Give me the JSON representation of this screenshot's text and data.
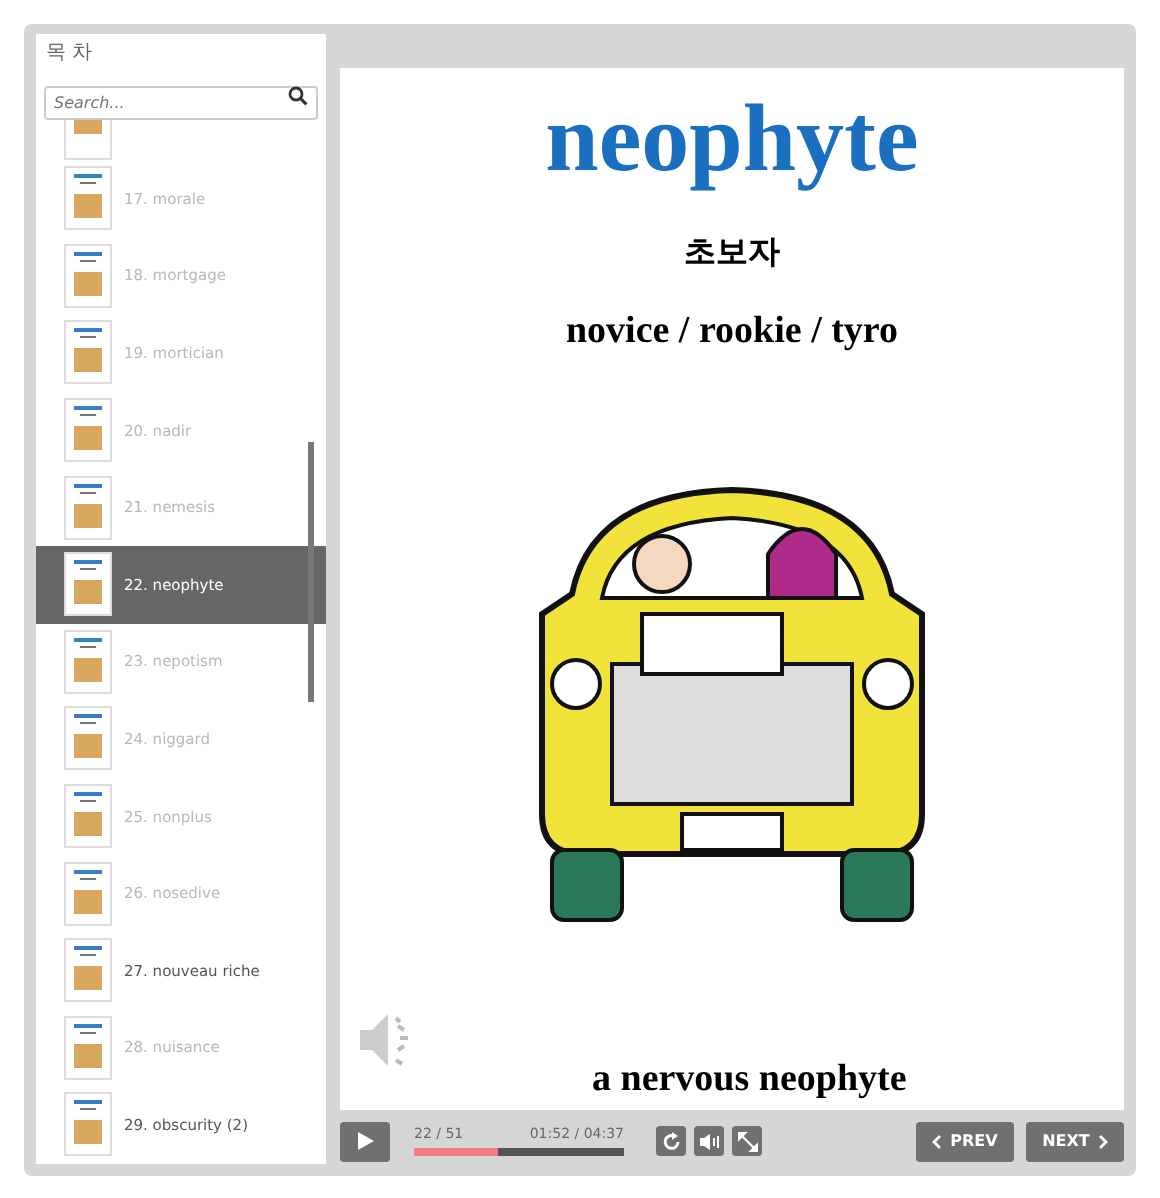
{
  "sidebar": {
    "title": "목 차",
    "search": {
      "placeholder": "Search..."
    },
    "items": [
      {
        "label": "17. morale",
        "selected": false,
        "viewed": true
      },
      {
        "label": "18. mortgage",
        "selected": false,
        "viewed": true
      },
      {
        "label": "19. mortician",
        "selected": false,
        "viewed": true
      },
      {
        "label": "20. nadir",
        "selected": false,
        "viewed": true
      },
      {
        "label": "21. nemesis",
        "selected": false,
        "viewed": true
      },
      {
        "label": "22. neophyte",
        "selected": true,
        "viewed": true
      },
      {
        "label": "23. nepotism",
        "selected": false,
        "viewed": true
      },
      {
        "label": "24. niggard",
        "selected": false,
        "viewed": true
      },
      {
        "label": "25. nonplus",
        "selected": false,
        "viewed": true
      },
      {
        "label": "26. nosedive",
        "selected": false,
        "viewed": true
      },
      {
        "label": "27. nouveau riche",
        "selected": false,
        "viewed": false
      },
      {
        "label": "28. nuisance",
        "selected": false,
        "viewed": true
      },
      {
        "label": "29. obscurity (2)",
        "selected": false,
        "viewed": false
      }
    ]
  },
  "slide": {
    "word": "neophyte",
    "korean": "초보자",
    "synonyms": "novice / rookie / tyro",
    "caption": "a nervous neophyte"
  },
  "player": {
    "slide_count": "22 / 51",
    "time": "01:52 / 04:37",
    "progress": {
      "level": 0.4
    },
    "prev": "PREV",
    "next": "NEXT"
  }
}
